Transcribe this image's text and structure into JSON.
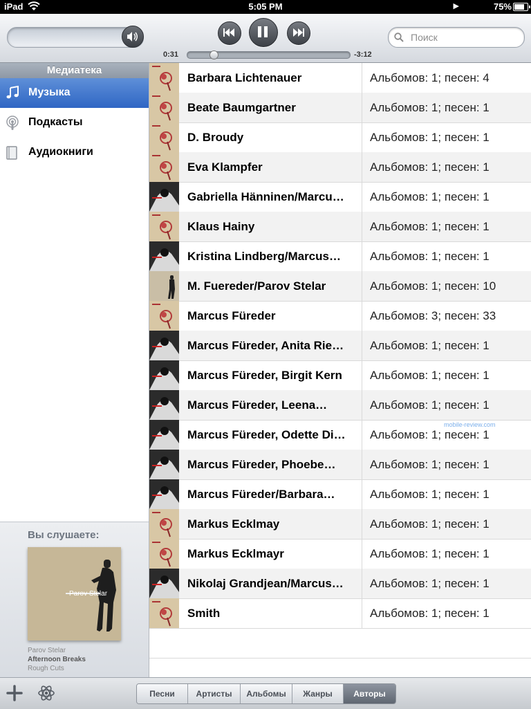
{
  "status_bar": {
    "carrier": "iPad",
    "time": "5:05 PM",
    "battery_text": "75%",
    "battery_level": 0.75
  },
  "toolbar": {
    "volume_level": 0.9,
    "search_placeholder": "Поиск",
    "elapsed": "0:31",
    "remaining": "-3:12",
    "progress": 0.14
  },
  "sidebar": {
    "header": "Медиатека",
    "items": [
      {
        "label": "Музыка",
        "icon": "music-note-icon",
        "selected": true
      },
      {
        "label": "Подкасты",
        "icon": "podcast-icon",
        "selected": false
      },
      {
        "label": "Аудиокниги",
        "icon": "audiobook-icon",
        "selected": false
      }
    ],
    "now_playing": {
      "title": "Вы слушаете:",
      "art_text": "Parov Stelar",
      "artist": "Parov Stelar",
      "song": "Afternoon Breaks",
      "album": "Rough Cuts"
    }
  },
  "artists": [
    {
      "name": "Barbara Lichtenauer",
      "count": "Альбомов: 1; песен: 4",
      "thumb": "light"
    },
    {
      "name": "Beate Baumgartner",
      "count": "Альбомов: 1; песен: 1",
      "thumb": "light"
    },
    {
      "name": "D. Broudy",
      "count": "Альбомов: 1; песен: 1",
      "thumb": "light"
    },
    {
      "name": "Eva Klampfer",
      "count": "Альбомов: 1; песен: 1",
      "thumb": "light"
    },
    {
      "name": "Gabriella Hänninen/Marcu…",
      "count": "Альбомов: 1; песен: 1",
      "thumb": "dark"
    },
    {
      "name": "Klaus Hainy",
      "count": "Альбомов: 1; песен: 1",
      "thumb": "light"
    },
    {
      "name": "Kristina Lindberg/Marcus…",
      "count": "Альбомов: 1; песен: 1",
      "thumb": "dark"
    },
    {
      "name": "M. Fuereder/Parov Stelar",
      "count": "Альбомов: 1; песен: 10",
      "thumb": "portrait"
    },
    {
      "name": "Marcus Füreder",
      "count": "Альбомов: 3; песен: 33",
      "thumb": "light"
    },
    {
      "name": "Marcus Füreder, Anita Rie…",
      "count": "Альбомов: 1; песен: 1",
      "thumb": "dark"
    },
    {
      "name": "Marcus Füreder, Birgit Kern",
      "count": "Альбомов: 1; песен: 1",
      "thumb": "dark"
    },
    {
      "name": "Marcus Füreder, Leena…",
      "count": "Альбомов: 1; песен: 1",
      "thumb": "dark"
    },
    {
      "name": "Marcus Füreder, Odette Di…",
      "count": "Альбомов: 1; песен: 1",
      "thumb": "dark"
    },
    {
      "name": "Marcus Füreder, Phoebe…",
      "count": "Альбомов: 1; песен: 1",
      "thumb": "dark"
    },
    {
      "name": "Marcus Füreder/Barbara…",
      "count": "Альбомов: 1; песен: 1",
      "thumb": "dark"
    },
    {
      "name": "Markus Ecklmay",
      "count": "Альбомов: 1; песен: 1",
      "thumb": "light"
    },
    {
      "name": "Markus Ecklmayr",
      "count": "Альбомов: 1; песен: 1",
      "thumb": "light"
    },
    {
      "name": "Nikolaj Grandjean/Marcus…",
      "count": "Альбомов: 1; песен: 1",
      "thumb": "dark"
    },
    {
      "name": "Smith",
      "count": "Альбомов: 1; песен: 1",
      "thumb": "light"
    }
  ],
  "bottom_tabs": [
    {
      "label": "Песни",
      "active": false
    },
    {
      "label": "Артисты",
      "active": false
    },
    {
      "label": "Альбомы",
      "active": false
    },
    {
      "label": "Жанры",
      "active": false
    },
    {
      "label": "Авторы",
      "active": true
    }
  ],
  "watermark": "mobile-review.com",
  "colors": {
    "selection_blue": "#2f66c4",
    "active_tab": "#5f6671"
  }
}
